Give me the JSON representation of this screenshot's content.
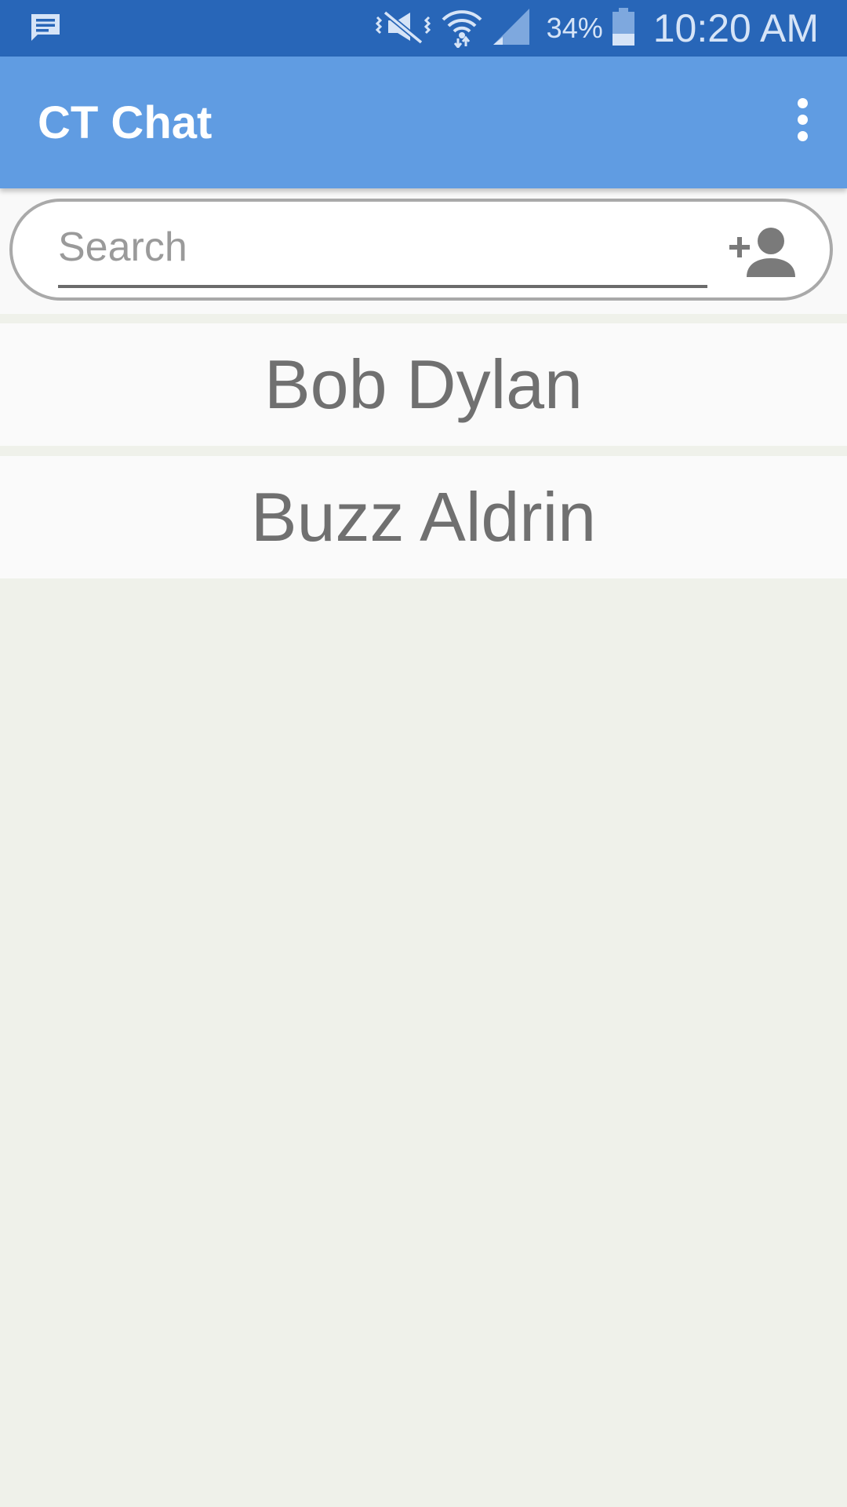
{
  "status_bar": {
    "battery_percent": "34%",
    "time": "10:20 AM",
    "icons": [
      "message-notification-icon",
      "vibrate-mute-icon",
      "wifi-icon",
      "cell-signal-icon",
      "battery-icon"
    ]
  },
  "app_bar": {
    "title": "CT Chat",
    "menu_icon": "overflow-menu-icon"
  },
  "search": {
    "placeholder": "Search",
    "value": "",
    "action_icon": "add-person-icon"
  },
  "contacts": [
    {
      "name": "Bob Dylan"
    },
    {
      "name": "Buzz Aldrin"
    }
  ],
  "colors": {
    "status_bar": "#2866b8",
    "app_bar": "#609ce2",
    "background": "#eff1ea",
    "list_item": "#fafafa",
    "contact_text": "#707070"
  }
}
